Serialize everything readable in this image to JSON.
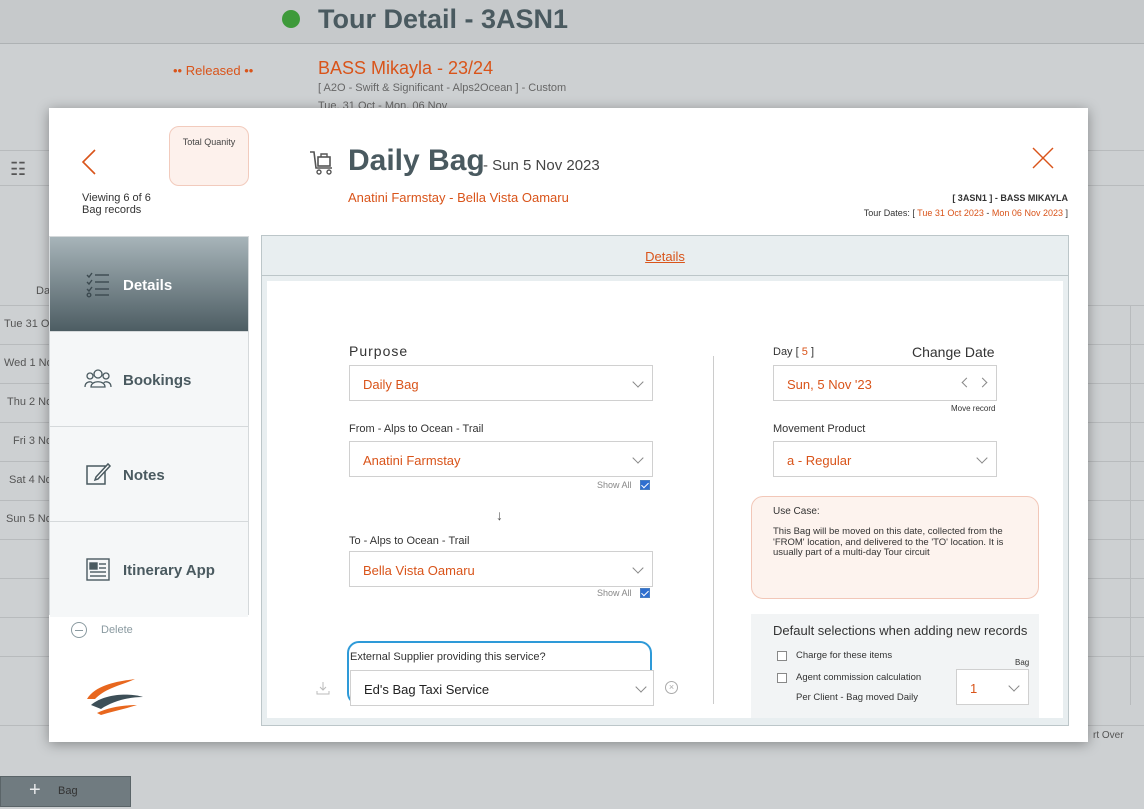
{
  "background": {
    "title": "Tour Detail - 3ASN1",
    "status": "•• Released ••",
    "client": "BASS Mikayla - 23/24",
    "subtitle": "[ A2O - Swift & Significant - Alps2Ocean ] - Custom",
    "date_range": "Tue, 31 Oct - Mon, 06 Nov",
    "column_header": "Da",
    "rows": [
      "Tue 31 O",
      "Wed 1 No",
      "Thu 2 No",
      "Fri 3 No",
      "Sat 4 No",
      "Sun 5 No"
    ],
    "start_over": "rt Over",
    "add_button": "Bag"
  },
  "modal": {
    "viewing_line1": "Viewing 6 of 6",
    "viewing_line2": "Bag records",
    "total_quantity_label": "Total Quanity",
    "title": "Daily Bag",
    "date": "- Sun 5 Nov 2023",
    "location": "Anatini Farmstay - Bella Vista Oamaru",
    "tour_code": "[ 3ASN1 ] - BASS MIKAYLA",
    "tour_dates_label": "Tour Dates: [",
    "tour_start": "Tue 31 Oct 2023",
    "tour_sep": "-",
    "tour_end": "Mon 06 Nov 2023",
    "tour_close": "]"
  },
  "nav": {
    "items": [
      {
        "label": "Details",
        "icon": "checklist-icon"
      },
      {
        "label": "Bookings",
        "icon": "people-icon"
      },
      {
        "label": "Notes",
        "icon": "edit-icon"
      },
      {
        "label": "Itinerary App",
        "icon": "newspaper-icon"
      }
    ],
    "delete": "Delete"
  },
  "details": {
    "tab": "Details",
    "purpose_label": "Purpose",
    "purpose_value": "Daily Bag",
    "from_label": "From - Alps to Ocean - Trail",
    "from_value": "Anatini Farmstay",
    "show_all": "Show All",
    "to_label": "To - Alps to Ocean - Trail",
    "to_value": "Bella Vista Oamaru",
    "supplier_label": "External Supplier providing this service?",
    "supplier_value": "Ed's Bag Taxi Service",
    "day_label": "Day [",
    "day_value": "5",
    "day_close": "]",
    "change_date": "Change Date",
    "date_value": "Sun, 5 Nov '23",
    "move_record": "Move record",
    "movement_label": "Movement Product",
    "movement_value": "a - Regular",
    "use_case_title": "Use Case:",
    "use_case_text": "This Bag will be moved on this date, collected from the 'FROM' location, and delivered to the 'TO' location. It is usually part of a multi-day Tour circuit",
    "defaults_title": "Default selections when adding new records",
    "charge_label": "Charge for these items",
    "agent_label": "Agent commission calculation",
    "per_client_label": "Per Client - Bag moved Daily",
    "bag_label": "Bag",
    "qty_value": "1"
  },
  "colors": {
    "accent": "#d9541a",
    "heading": "#4a5a60",
    "highlight": "#2e9ad8",
    "status_green": "#3e9a3a"
  }
}
